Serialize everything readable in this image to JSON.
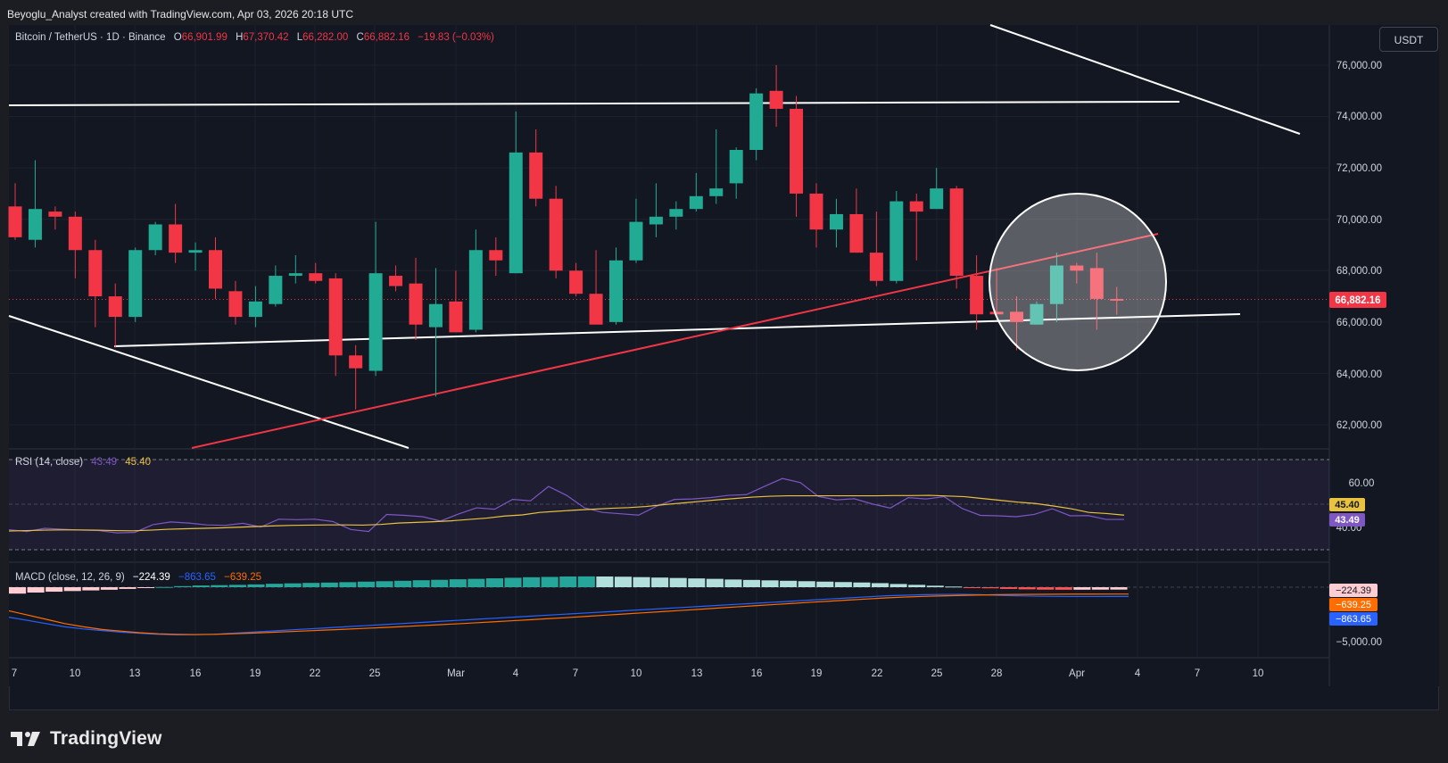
{
  "header": {
    "text": "Beyoglu_Analyst created with TradingView.com, Apr 03, 2026 20:18 UTC"
  },
  "symbol": {
    "name": "Bitcoin / TetherUS · 1D · Binance",
    "open_label": "O",
    "open": "66,901.99",
    "high_label": "H",
    "high": "67,370.42",
    "low_label": "L",
    "low": "66,282.00",
    "close_label": "C",
    "close": "66,882.16",
    "change": "−19.83 (−0.03%)"
  },
  "currency": "USDT",
  "price_axis": {
    "ticks": [
      "76,000.00",
      "74,000.00",
      "72,000.00",
      "70,000.00",
      "68,000.00",
      "66,000.00",
      "64,000.00",
      "62,000.00"
    ],
    "current_price": "66,882.16",
    "current_value": 66882.16
  },
  "time_axis": {
    "labels": [
      "7",
      "10",
      "13",
      "16",
      "19",
      "22",
      "25",
      "Mar",
      "4",
      "7",
      "10",
      "13",
      "16",
      "19",
      "22",
      "25",
      "28",
      "Apr",
      "4",
      "7",
      "10"
    ]
  },
  "rsi": {
    "label": "RSI (14, close)",
    "value1": "43.49",
    "value2": "45.40",
    "axis": [
      "60.00",
      "40.00"
    ],
    "badge_ma": "45.40",
    "badge_rsi": "43.49"
  },
  "macd": {
    "label": "MACD (close, 12, 26, 9)",
    "hist": "−224.39",
    "macd": "−863.65",
    "signal": "−639.25",
    "axis": [
      "−5,000.00"
    ],
    "badge_hist": "−224.39",
    "badge_signal": "−639.25",
    "badge_macd": "−863.65"
  },
  "colors": {
    "up": "#22ab94",
    "down": "#f23645",
    "rsi": "#7e57c2",
    "rsi_ma": "#e9c33f",
    "macd": "#2962ff",
    "signal": "#ff6d00"
  },
  "footer": {
    "brand": "TradingView",
    "logo_icon": "tradingview-logo-icon"
  },
  "chart_data": {
    "type": "candlestick",
    "series": [
      {
        "name": "Bitcoin / TetherUS",
        "values": [
          [
            70500,
            71400,
            69200,
            69300
          ],
          [
            69200,
            72300,
            68900,
            70400
          ],
          [
            70300,
            70500,
            69600,
            70100
          ],
          [
            70100,
            70300,
            67700,
            68800
          ],
          [
            68800,
            69200,
            65800,
            67000
          ],
          [
            67000,
            67500,
            65000,
            66200
          ],
          [
            66200,
            68900,
            66000,
            68800
          ],
          [
            68800,
            69900,
            68600,
            69800
          ],
          [
            69800,
            70600,
            68300,
            68700
          ],
          [
            68700,
            69100,
            68000,
            68800
          ],
          [
            68800,
            69300,
            66900,
            67300
          ],
          [
            67200,
            67600,
            65900,
            66200
          ],
          [
            66200,
            67400,
            65800,
            66800
          ],
          [
            66700,
            68200,
            66600,
            67800
          ],
          [
            67800,
            68600,
            67500,
            67900
          ],
          [
            67900,
            68300,
            67500,
            67600
          ],
          [
            67700,
            67900,
            63900,
            64700
          ],
          [
            64700,
            65100,
            62600,
            64200
          ],
          [
            64100,
            69900,
            63900,
            67900
          ],
          [
            67800,
            68200,
            67200,
            67400
          ],
          [
            67500,
            68500,
            65300,
            65900
          ],
          [
            65800,
            68100,
            63100,
            66700
          ],
          [
            66800,
            68000,
            65600,
            65600
          ],
          [
            65700,
            69600,
            65600,
            68800
          ],
          [
            68800,
            69300,
            67800,
            68400
          ],
          [
            67900,
            74200,
            67900,
            72600
          ],
          [
            72600,
            73500,
            70500,
            70800
          ],
          [
            70800,
            71300,
            67700,
            68000
          ],
          [
            68000,
            68300,
            67000,
            67100
          ],
          [
            67100,
            68800,
            66900,
            65900
          ],
          [
            66000,
            68900,
            65900,
            68400
          ],
          [
            68400,
            70800,
            68300,
            69900
          ],
          [
            69800,
            71400,
            69300,
            70100
          ],
          [
            70100,
            70700,
            69600,
            70400
          ],
          [
            70400,
            71800,
            70300,
            70900
          ],
          [
            70900,
            73500,
            70600,
            71200
          ],
          [
            71400,
            72800,
            70800,
            72700
          ],
          [
            72700,
            75100,
            72300,
            74900
          ],
          [
            75000,
            76000,
            73600,
            74300
          ],
          [
            74300,
            74800,
            70100,
            71000
          ],
          [
            71000,
            71400,
            68900,
            69600
          ],
          [
            69600,
            70800,
            68900,
            70200
          ],
          [
            70200,
            71200,
            68700,
            68700
          ],
          [
            68700,
            70300,
            67400,
            67600
          ],
          [
            67600,
            71100,
            67500,
            70700
          ],
          [
            70700,
            71000,
            68400,
            70300
          ],
          [
            70400,
            72000,
            70400,
            71200
          ],
          [
            71200,
            71300,
            67300,
            67800
          ],
          [
            67800,
            68600,
            65700,
            66300
          ],
          [
            66400,
            68100,
            66200,
            66300
          ],
          [
            66400,
            67000,
            64900,
            66000
          ],
          [
            65900,
            66800,
            65900,
            66700
          ],
          [
            66700,
            68700,
            66000,
            68200
          ],
          [
            68200,
            68300,
            67500,
            68000
          ],
          [
            68100,
            68700,
            65700,
            66900
          ],
          [
            66900,
            67370,
            66282,
            66882
          ]
        ]
      }
    ],
    "y_range": [
      61200,
      77200
    ],
    "rsi_series": [
      [
        39.0,
        38.2,
        39.6,
        39.2,
        38.8,
        38.6,
        37.6,
        37.8,
        41.2,
        42.4,
        41.9,
        41.1,
        40.9,
        41.8,
        40.2,
        43.6,
        43.4,
        43.6,
        42.6,
        39.1,
        38.2,
        45.7,
        45.3,
        44.7,
        42.8,
        45.9,
        48.6,
        48.0,
        52.3,
        51.7,
        58.0,
        54.1,
        48.6,
        46.6,
        46.0,
        45.4,
        49.3,
        52.3,
        52.5,
        53.1,
        54.1,
        54.4,
        58.0,
        61.5,
        59.7,
        53.6,
        52.1,
        52.6,
        50.3,
        48.5,
        53.1,
        52.5,
        53.5,
        48.3,
        45.3,
        45.1,
        44.7,
        45.7,
        48.2,
        45.1,
        45.2,
        43.5,
        43.5
      ],
      [
        38.4,
        38.6,
        38.8,
        38.9,
        38.9,
        38.8,
        38.6,
        38.5,
        38.8,
        39.2,
        39.4,
        39.6,
        39.8,
        40.1,
        40.4,
        40.7,
        40.9,
        41.0,
        41.1,
        41.1,
        41.0,
        41.3,
        41.9,
        42.2,
        42.5,
        42.9,
        43.5,
        44.1,
        45.0,
        45.5,
        46.6,
        47.1,
        47.6,
        48.0,
        48.4,
        48.7,
        49.2,
        50.0,
        50.7,
        51.4,
        52.1,
        52.7,
        53.3,
        53.7,
        53.9,
        53.9,
        53.9,
        53.9,
        53.9,
        53.9,
        54.0,
        54.0,
        54.1,
        53.8,
        53.5,
        52.7,
        51.9,
        51.1,
        50.5,
        49.4,
        48.2,
        46.6,
        46.1,
        45.4
      ]
    ],
    "macd_series": {
      "histogram": [
        -600,
        -500,
        -420,
        -360,
        -300,
        -240,
        -160,
        -80,
        20,
        100,
        160,
        190,
        220,
        260,
        320,
        360,
        400,
        430,
        470,
        520,
        560,
        600,
        650,
        690,
        740,
        780,
        830,
        880,
        930,
        960,
        1000,
        1010,
        1000,
        980,
        940,
        900,
        860,
        820,
        780,
        720,
        680,
        640,
        600,
        560,
        520,
        480,
        440,
        380,
        300,
        220,
        140,
        60,
        -20,
        -100,
        -160,
        -200,
        -230,
        -240,
        -235,
        -228,
        -224
      ],
      "macd": [
        -2800,
        -3100,
        -3400,
        -3700,
        -3900,
        -4050,
        -4200,
        -4300,
        -4400,
        -4450,
        -4430,
        -4400,
        -4300,
        -4200,
        -4100,
        -4000,
        -3900,
        -3800,
        -3700,
        -3600,
        -3500,
        -3400,
        -3300,
        -3200,
        -3100,
        -3000,
        -2900,
        -2800,
        -2700,
        -2600,
        -2500,
        -2400,
        -2300,
        -2200,
        -2100,
        -2000,
        -1900,
        -1800,
        -1700,
        -1600,
        -1500,
        -1400,
        -1300,
        -1200,
        -1100,
        -1000,
        -900,
        -800,
        -750,
        -700,
        -680,
        -660,
        -700,
        -760,
        -800,
        -840,
        -860,
        -870,
        -868,
        -865,
        -863
      ],
      "signal": [
        -2200,
        -2600,
        -3000,
        -3400,
        -3700,
        -3950,
        -4100,
        -4250,
        -4350,
        -4400,
        -4420,
        -4400,
        -4350,
        -4290,
        -4220,
        -4150,
        -4080,
        -4000,
        -3930,
        -3850,
        -3770,
        -3690,
        -3600,
        -3510,
        -3420,
        -3330,
        -3230,
        -3130,
        -3030,
        -2930,
        -2830,
        -2720,
        -2610,
        -2500,
        -2390,
        -2280,
        -2170,
        -2060,
        -1950,
        -1840,
        -1730,
        -1620,
        -1510,
        -1400,
        -1300,
        -1200,
        -1100,
        -1000,
        -920,
        -860,
        -810,
        -770,
        -730,
        -700,
        -680,
        -665,
        -655,
        -648,
        -644,
        -641,
        -639
      ]
    }
  }
}
